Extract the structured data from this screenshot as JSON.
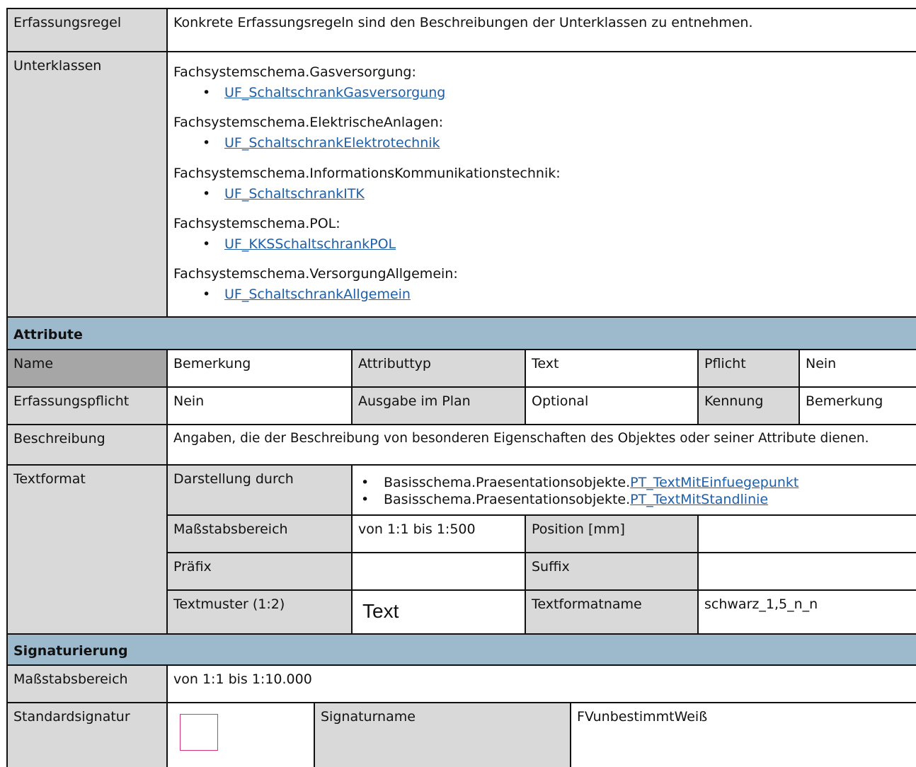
{
  "erfassungsregel": {
    "label": "Erfassungsregel",
    "text": "Konkrete Erfassungsregeln sind den Beschreibungen der Unterklassen zu entnehmen."
  },
  "unterklassen": {
    "label": "Unterklassen",
    "groups": [
      {
        "schema": "Fachsystemschema.Gasversorgung:",
        "link": "UF_SchaltschrankGasversorgung"
      },
      {
        "schema": "Fachsystemschema.ElektrischeAnlagen:",
        "link": "UF_SchaltschrankElektrotechnik"
      },
      {
        "schema": "Fachsystemschema.InformationsKommunikationstechnik:",
        "link": "UF_SchaltschrankITK"
      },
      {
        "schema": "Fachsystemschema.POL:",
        "link": "UF_KKSSchaltschrankPOL"
      },
      {
        "schema": "Fachsystemschema.VersorgungAllgemein:",
        "link": "UF_SchaltschrankAllgemein"
      }
    ],
    "bullet": "•"
  },
  "attribute": {
    "header": "Attribute",
    "name_label": "Name",
    "name_value": "Bemerkung",
    "typ_label": "Attributtyp",
    "typ_value": "Text",
    "pflicht_label": "Pflicht",
    "pflicht_value": "Nein",
    "erf_label": "Erfassungspflicht",
    "erf_value": "Nein",
    "ausgabe_label": "Ausgabe im Plan",
    "ausgabe_value": "Optional",
    "kennung_label": "Kennung",
    "kennung_value": "Bemerkung",
    "beschreibung_label": "Beschreibung",
    "beschreibung_value": "Angaben, die der Beschreibung von besonderen Eigenschaften des Objektes oder seiner Attribute dienen.",
    "textformat_label": "Textformat",
    "darstellung_label": "Darstellung durch",
    "darstellung_items": [
      {
        "prefix": "Basisschema.Praesentationsobjekte.",
        "link": "PT_TextMitEinfuegepunkt"
      },
      {
        "prefix": "Basisschema.Praesentationsobjekte.",
        "link": "PT_TextMitStandlinie"
      }
    ],
    "massstab_label": "Maßstabsbereich",
    "massstab_value": "von 1:1 bis 1:500",
    "position_label": "Position [mm]",
    "position_value": "",
    "praefix_label": "Präfix",
    "praefix_value": "",
    "suffix_label": "Suffix",
    "suffix_value": "",
    "textmuster_label": "Textmuster (1:2)",
    "textmuster_value": "Text",
    "textformatname_label": "Textformatname",
    "textformatname_value": "schwarz_1,5_n_n"
  },
  "signaturierung": {
    "header": "Signaturierung",
    "massstab_label": "Maßstabsbereich",
    "massstab_value": "von 1:1 bis 1:10.000",
    "standard_label": "Standardsignatur",
    "signaturname_label": "Signaturname",
    "signaturname_value": "FVunbestimmtWeiß",
    "symbol_color": "#d6337a"
  },
  "colors": {
    "label_gray": "#d9d9d9",
    "name_gray": "#a6a6a6",
    "section_blue": "#9db9cc",
    "link": "#1f5fa8"
  }
}
